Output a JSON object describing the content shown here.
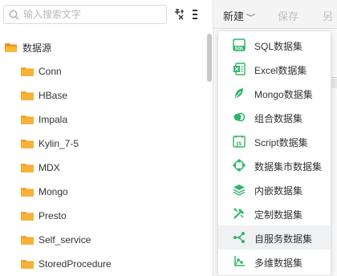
{
  "search": {
    "placeholder": "输入搜索文字"
  },
  "tree": {
    "root": {
      "label": "数据源"
    },
    "items": [
      {
        "label": "Conn"
      },
      {
        "label": "HBase"
      },
      {
        "label": "Impala"
      },
      {
        "label": "Kylin_7-5"
      },
      {
        "label": "MDX"
      },
      {
        "label": "Mongo"
      },
      {
        "label": "Presto"
      },
      {
        "label": "Self_service"
      },
      {
        "label": "StoredProcedure"
      }
    ]
  },
  "toolbar": {
    "new_label": "新建",
    "save_label": "保存",
    "other_label": "另"
  },
  "menu": {
    "items": [
      {
        "label": "SQL数据集",
        "icon": "sql-icon"
      },
      {
        "label": "Excel数据集",
        "icon": "excel-icon"
      },
      {
        "label": "Mongo数据集",
        "icon": "mongo-leaf-icon"
      },
      {
        "label": "组合数据集",
        "icon": "combine-icon"
      },
      {
        "label": "Script数据集",
        "icon": "script-icon"
      },
      {
        "label": "数据集市数据集",
        "icon": "datamart-icon"
      },
      {
        "label": "内嵌数据集",
        "icon": "embedded-icon"
      },
      {
        "label": "定制数据集",
        "icon": "custom-icon"
      },
      {
        "label": "自服务数据集",
        "icon": "self-service-icon"
      },
      {
        "label": "多维数据集",
        "icon": "olap-icon"
      }
    ],
    "highlighted_index": 8
  },
  "colors": {
    "folder": "#f5a623",
    "menu_icon": "#2fb56a",
    "highlight": "#f0f1f3"
  }
}
